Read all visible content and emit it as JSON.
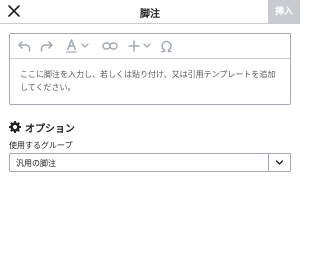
{
  "header": {
    "title": "脚注",
    "insert_label": "挿入",
    "close_icon": "close-icon",
    "insert_color": "#c8ccd1"
  },
  "editor": {
    "toolbar": [
      {
        "name": "undo",
        "icon": "undo-icon",
        "enabled": false
      },
      {
        "name": "redo",
        "icon": "redo-icon",
        "enabled": false
      },
      {
        "name": "text-style",
        "icon": "text-style-icon",
        "enabled": false
      },
      {
        "name": "link",
        "icon": "link-icon",
        "enabled": false
      },
      {
        "name": "insert",
        "icon": "plus-icon",
        "enabled": false
      },
      {
        "name": "special-character",
        "icon": "omega-icon",
        "enabled": false
      }
    ],
    "placeholder": "ここに脚注を入力し、若しくは貼り付け、又は引用テンプレートを追加してください。"
  },
  "options": {
    "title": "オプション",
    "icon": "gear-icon",
    "group_label": "使用するグループ",
    "group_value": "汎用の脚注"
  }
}
